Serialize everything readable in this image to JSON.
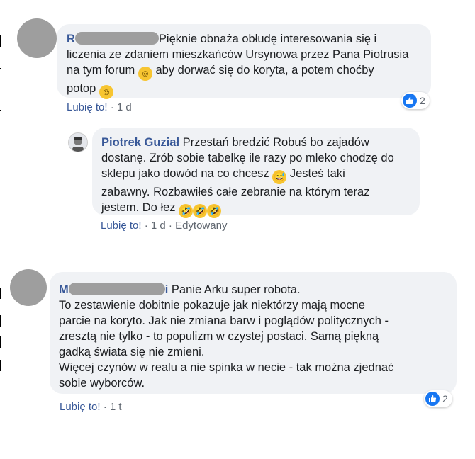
{
  "comments": [
    {
      "author_initial": "R",
      "text": "Pięknie obnaża obłudę interesowania się i\nliczenia ze zdaniem mieszkańców Ursynowa przez Pana Piotrusia\nna tym forum ",
      "text_b": " aby dorwać się do koryta, a potem choćby\npotop ",
      "like_label": "Lubię to!",
      "meta": "· 1 d",
      "reactions": "2"
    },
    {
      "author": "Piotrek Guział",
      "text": " Przestań bredzić Robuś bo zajadów\ndostanę. Zrób sobie tabelkę ile razy po mleko chodzę do\nsklepu jako dowód na co chcesz ",
      "text_b": " Jesteś taki\nzabawny. Rozbawiłeś całe zebranie na którym teraz\njestem. Do łez ",
      "like_label": "Lubię to!",
      "meta": "· 1 d · Edytowany"
    },
    {
      "author_initial": "M",
      "name_tail": "i",
      "text": " Panie Arku super robota.\nTo zestawienie dobitnie pokazuje jak niektórzy mają mocne\nparcie na koryto. Jak nie zmiana barw i poglądów politycznych -\nzresztą nie tylko - to populizm w czystej postaci. Samą piękną\ngadką świata się nie zmieni.\nWięcej czynów w realu a nie spinka w necie - tak można zjednać\nsobie wyborców.",
      "like_label": "Lubię to!",
      "meta": "· 1 t",
      "reactions": "2"
    }
  ],
  "colors": {
    "link": "#385898",
    "bubble": "#f0f2f5",
    "like": "#1877f2"
  },
  "icons": [
    "smile-emoji-icon",
    "laugh-sweat-emoji-icon",
    "rofl-emoji-icon",
    "like-thumb-icon"
  ]
}
